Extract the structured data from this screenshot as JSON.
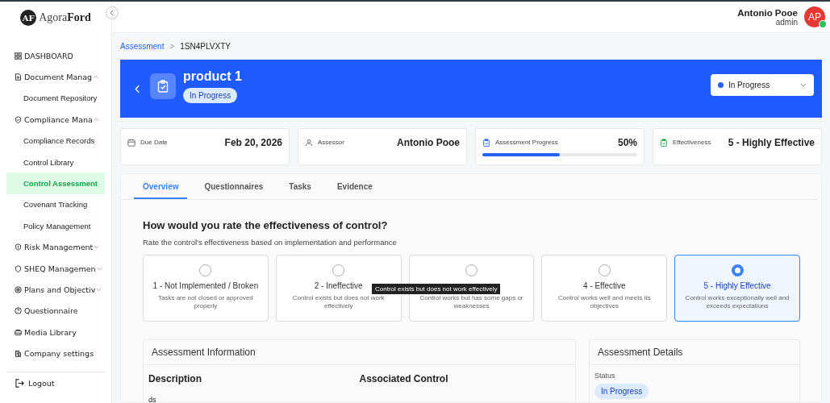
{
  "brand": {
    "mark": "AF",
    "name_light": "Agora",
    "name_bold": "Ford"
  },
  "sidebar": {
    "items": [
      {
        "label": "DASHBOARD"
      },
      {
        "label": "Document Manag",
        "expanded": true,
        "children": [
          {
            "label": "Document Repository",
            "selected": false
          }
        ]
      },
      {
        "label": "Compliance Mana",
        "expanded": true,
        "children": [
          {
            "label": "Compliance Records",
            "selected": false
          },
          {
            "label": "Control Library",
            "selected": false
          },
          {
            "label": "Control Assessment",
            "selected": true
          },
          {
            "label": "Covenant Tracking",
            "selected": false
          },
          {
            "label": "Policy Management",
            "selected": false
          }
        ]
      },
      {
        "label": "Risk Management",
        "expanded": false
      },
      {
        "label": "SHEQ Managemen",
        "expanded": false
      },
      {
        "label": "Plans and Objectiv",
        "expanded": false
      },
      {
        "label": "Questionnaire"
      },
      {
        "label": "Media Library"
      },
      {
        "label": "Company settings"
      }
    ],
    "logout": "Logout"
  },
  "user": {
    "name": "Antonio Pooe",
    "role": "admin",
    "initials": "AP",
    "online": true
  },
  "breadcrumb": {
    "items": [
      "Assessment",
      "1SN4PLVXTY"
    ],
    "separator": ">"
  },
  "header": {
    "title": "product 1",
    "status": "In Progress",
    "status_select": "In Progress"
  },
  "stats": [
    {
      "label": "Due Date",
      "value": "Feb 20, 2026"
    },
    {
      "label": "Assessor",
      "value": "Antonio Pooe"
    },
    {
      "label": "Assessment Progress",
      "value": "50%",
      "level": 0.5
    },
    {
      "label": "Effectiveness",
      "value": "5 - Highly Effective"
    }
  ],
  "tabs": [
    {
      "label": "Overview",
      "selected": true
    },
    {
      "label": "Questionnaires",
      "selected": false
    },
    {
      "label": "Tasks",
      "selected": false
    },
    {
      "label": "Evidence",
      "selected": false
    }
  ],
  "rating": {
    "question": "How would you rate the effectiveness of control?",
    "hint": "Rate the control's effectiveness based on implementation and performance",
    "options": [
      {
        "title": "1 - Not Implemented / Broken",
        "desc": "Tasks are not closed or approved properly",
        "selected": false
      },
      {
        "title": "2 - Ineffective",
        "desc": "Control exists but does not work effectively",
        "selected": false
      },
      {
        "desc": "Control works but has some gaps or weaknesses",
        "selected": false
      },
      {
        "title": "4 - Effective",
        "desc": "Control works well and meets its objectives",
        "selected": false
      },
      {
        "title": "5 - Highly Effective",
        "desc": "Control works exceptionally well and exceeds expectations",
        "selected": true
      }
    ],
    "tooltip": "Control exists but does not work effectively"
  },
  "info": {
    "title": "Assessment Information",
    "description_label": "Description",
    "description": "ds",
    "control_label": "Associated Control"
  },
  "details": {
    "title": "Assessment Details",
    "status_label": "Status",
    "status": "In Progress"
  }
}
